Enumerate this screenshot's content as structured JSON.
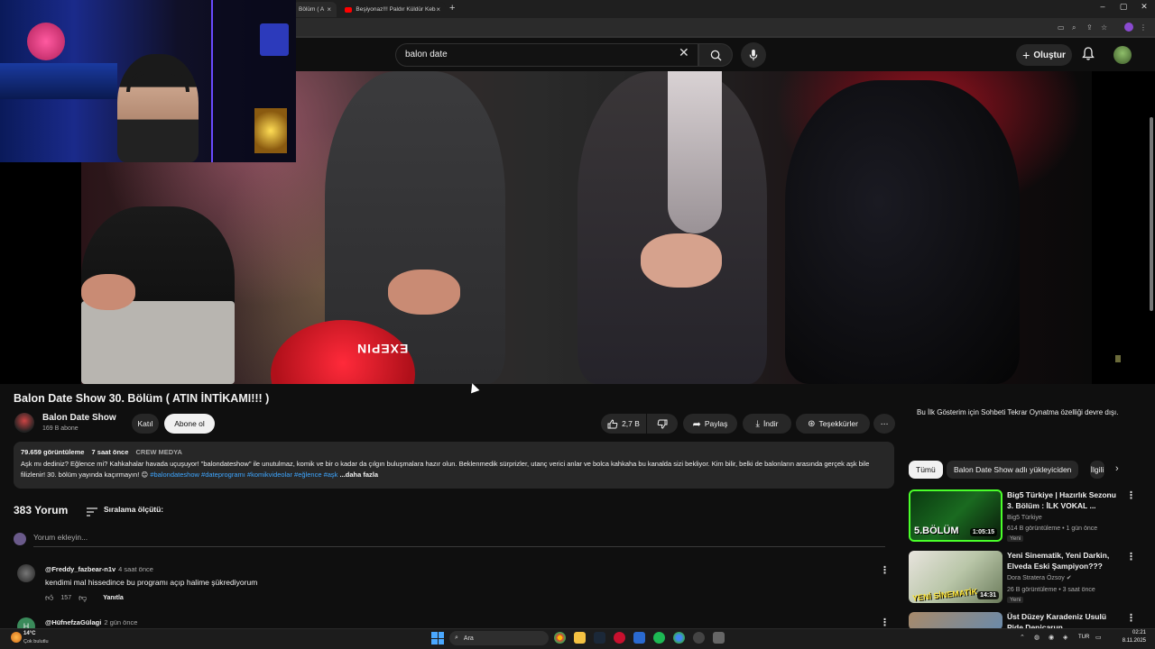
{
  "browser": {
    "tabs": [
      {
        "label": "Bölüm ( A",
        "active": true
      },
      {
        "label": "Beşiyonaz!!! Paldır Küldür Kebab",
        "active": false
      }
    ],
    "new_tab": "+",
    "window_controls": {
      "minimize": "–",
      "maximize": "▢",
      "close": "✕"
    }
  },
  "header": {
    "search_value": "balon date",
    "create_label": "Oluştur"
  },
  "video": {
    "title": "Balon Date Show 30. Bölüm ( ATIN İNTİKAMI!!! )",
    "balloon_print": "EXEPIN"
  },
  "channel": {
    "name": "Balon Date Show",
    "subscribers": "169 B abone",
    "join_label": "Katıl",
    "subscribe_label": "Abone ol"
  },
  "actions": {
    "likes": "2,7 B",
    "share": "Paylaş",
    "download": "İndir",
    "thanks": "Teşekkürler",
    "more": "⋯"
  },
  "description": {
    "views": "79.659 görüntüleme",
    "time": "7 saat önce",
    "producer": "CREW MEDYA",
    "text": "Aşk mı dediniz? Eğlence mi? Kahkahalar havada uçuşuyor! \"balondateshow\" ile unutulmaz, komik ve bir o kadar da çılgın buluşmalara hazır olun. Beklenmedik sürprizler, utanç verici anlar ve bolca kahkaha bu kanalda sizi bekliyor. Kim bilir, belki de balonların arasında gerçek aşk bile filizlenir! 30. bölüm yayında kaçırmayın! 😊",
    "hashtags": [
      "#balondateshow",
      "#dateprogramı",
      "#komikvideolar",
      "#eğlence",
      "#aşk"
    ],
    "more": "...daha fazla"
  },
  "comments": {
    "count": "383 Yorum",
    "sort_label": "Sıralama ölçütü:",
    "add_placeholder": "Yorum ekleyin...",
    "items": [
      {
        "author": "@Freddy_fazbear-n1v",
        "time": "4 saat önce",
        "text": "kendimi mal hissedince bu programı açıp halime şükrediyorum",
        "likes": "157",
        "reply": "Yanıtla"
      },
      {
        "author": "@HüfnefzaGülagi",
        "time": "2 gün önce",
        "avatar_letter": "H"
      }
    ]
  },
  "sidebar": {
    "chat_notice": "Bu İlk Gösterim için Sohbeti Tekrar Oynatma özelliği devre dışı.",
    "chips": [
      "Tümü",
      "Balon Date Show adlı yükleyiciden",
      "İlgili"
    ],
    "videos": [
      {
        "title": "Big5 Türkiye | Hazırlık Sezonu 3. Bölüm : İLK VOKAL ...",
        "channel": "Big5 Türkiye",
        "meta": "614 B görüntüleme • 1 gün önce",
        "badge": "Yeni",
        "duration": "1:05:15",
        "thumb_label": "5.BÖLÜM"
      },
      {
        "title": "Yeni Sinematik, Yeni Darkin, Elveda Eski Şampiyon???",
        "channel": "Dora Stratera Özsoy",
        "meta": "26 B görüntüleme • 3 saat önce",
        "badge": "Yeni",
        "duration": "14:31",
        "thumb_label": "YENİ SİNEMATİK"
      },
      {
        "title": "Üst Düzey Karadeniz Usulü Pide Denicarun"
      }
    ]
  },
  "taskbar": {
    "weather_temp": "14°C",
    "weather_desc": "Çok bulutlu",
    "search_label": "Ara",
    "lang": "TUR",
    "time": "02:21",
    "date": "8.11.2025"
  },
  "colors": {
    "background": "#0f0f0f",
    "surface": "#272727",
    "link": "#3ea6ff",
    "brand": "#ff0000"
  }
}
